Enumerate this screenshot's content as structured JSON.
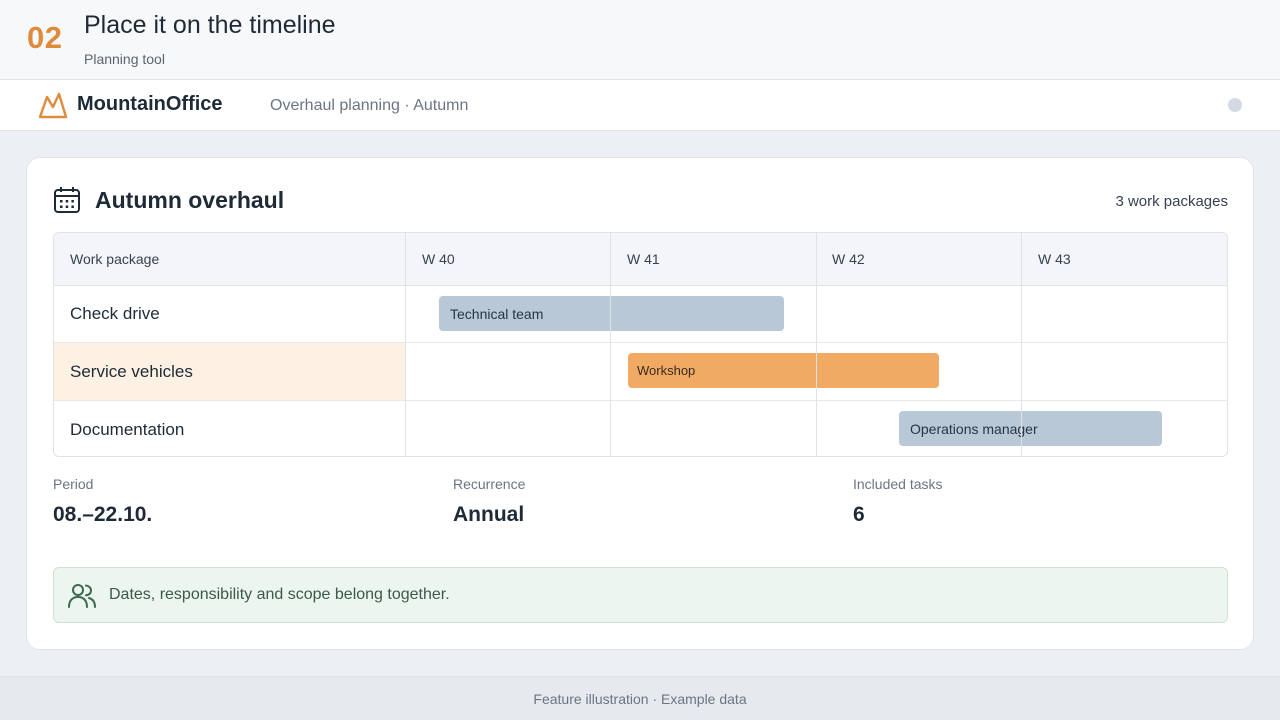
{
  "header": {
    "step": "02",
    "title": "Place it on the timeline",
    "subtitle": "Planning tool"
  },
  "appbar": {
    "logo_icon": "mountain-icon",
    "brand": "MountainOffice",
    "context": "Overhaul planning · Autumn",
    "status_icon": "status-dot-icon"
  },
  "card": {
    "icon": "calendar-icon",
    "title": "Autumn overhaul",
    "count": "3 work packages"
  },
  "table": {
    "column_header": "Work package",
    "weeks": [
      "W 40",
      "W 41",
      "W 42",
      "W 43"
    ],
    "rows": [
      {
        "label": "Check drive",
        "bar_label": "Technical team",
        "bar_color": "#b8c8d6",
        "highlighted": false
      },
      {
        "label": "Service vehicles",
        "bar_label": "Workshop",
        "bar_color": "#f0aa64",
        "highlighted": true
      },
      {
        "label": "Documentation",
        "bar_label": "Operations manager",
        "bar_color": "#b8c8d6",
        "highlighted": false
      }
    ]
  },
  "stats": [
    {
      "label": "Period",
      "value": "08.–22.10."
    },
    {
      "label": "Recurrence",
      "value": "Annual"
    },
    {
      "label": "Included tasks",
      "value": "6"
    }
  ],
  "note": {
    "icon": "users-icon",
    "text": "Dates, responsibility and scope belong together."
  },
  "footer": {
    "text": "Feature illustration · Example data"
  },
  "colors": {
    "accent": "#e08a3c",
    "highlight": "#fdf1e4",
    "note_bg": "#ecf5ef"
  }
}
